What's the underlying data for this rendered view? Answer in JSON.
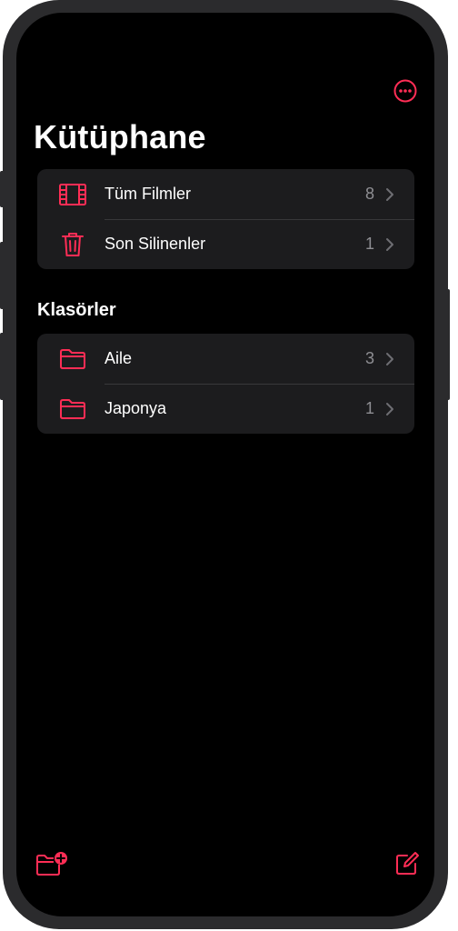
{
  "header": {
    "more_icon": "ellipsis-circle-icon",
    "title": "Kütüphane"
  },
  "library": {
    "items": [
      {
        "label": "Tüm Filmler",
        "count": "8",
        "icon": "film-icon"
      },
      {
        "label": "Son Silinenler",
        "count": "1",
        "icon": "trash-icon"
      }
    ]
  },
  "folders": {
    "title": "Klasörler",
    "items": [
      {
        "label": "Aile",
        "count": "3",
        "icon": "folder-icon"
      },
      {
        "label": "Japonya",
        "count": "1",
        "icon": "folder-icon"
      }
    ]
  },
  "toolbar": {
    "new_folder_icon": "folder-badge-plus-icon",
    "compose_icon": "square-and-pencil-icon"
  },
  "colors": {
    "accent": "#ff2d55",
    "background": "#000000",
    "cell": "#1c1c1e",
    "separator": "#38383a",
    "secondary_text": "#8e8e93"
  }
}
